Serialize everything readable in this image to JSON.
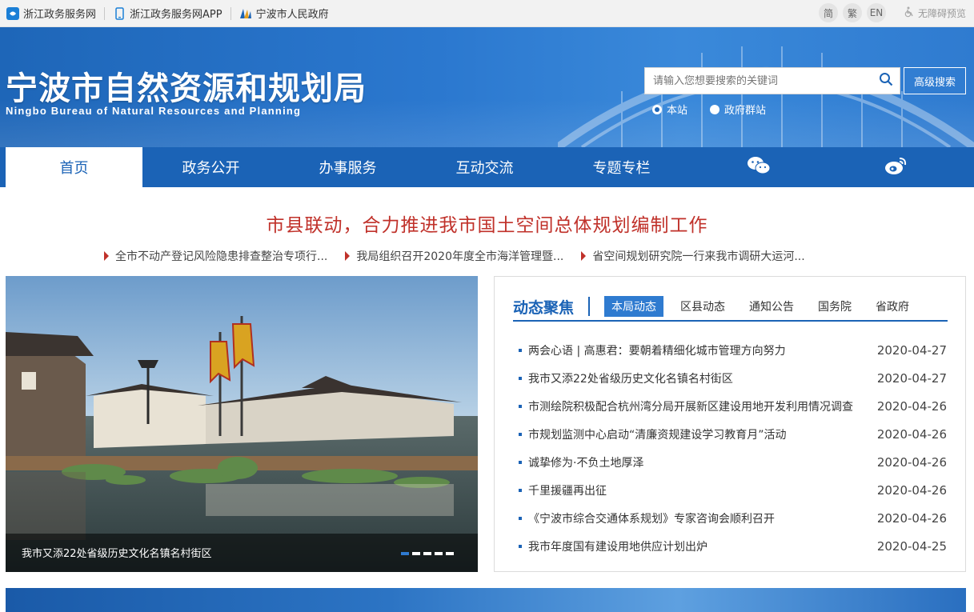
{
  "topbar": {
    "links": [
      {
        "label": "浙江政务服务网"
      },
      {
        "label": "浙江政务服务网APP"
      },
      {
        "label": "宁波市人民政府"
      }
    ],
    "lang": [
      "简",
      "繁",
      "EN"
    ],
    "accessibility": "无障碍预览"
  },
  "header": {
    "title": "宁波市自然资源和规划局",
    "subtitle": "Ningbo Bureau of Natural Resources and Planning",
    "search_placeholder": "请输入您想要搜索的关键词",
    "advanced_search": "高级搜索",
    "scope": [
      "本站",
      "政府群站"
    ]
  },
  "nav": {
    "items": [
      "首页",
      "政务公开",
      "办事服务",
      "互动交流",
      "专题专栏"
    ]
  },
  "headline": "市县联动，合力推进我市国土空间总体规划编制工作",
  "sublinks": [
    "全市不动产登记风险隐患排查整治专项行...",
    "我局组织召开2020年度全市海洋管理暨...",
    "省空间规划研究院一行来我市调研大运河..."
  ],
  "slider": {
    "caption": "我市又添22处省级历史文化名镇名村街区"
  },
  "news": {
    "title": "动态聚焦",
    "tabs": [
      "本局动态",
      "区县动态",
      "通知公告",
      "国务院",
      "省政府"
    ],
    "items": [
      {
        "title": "两会心语 | 高惠君：要朝着精细化城市管理方向努力",
        "date": "2020-04-27"
      },
      {
        "title": "我市又添22处省级历史文化名镇名村街区",
        "date": "2020-04-27"
      },
      {
        "title": "市测绘院积极配合杭州湾分局开展新区建设用地开发利用情况调查",
        "date": "2020-04-26"
      },
      {
        "title": "市规划监测中心启动“清廉资规建设学习教育月”活动",
        "date": "2020-04-26"
      },
      {
        "title": "诚挚修为·不负土地厚泽",
        "date": "2020-04-26"
      },
      {
        "title": "千里援疆再出征",
        "date": "2020-04-26"
      },
      {
        "title": "《宁波市综合交通体系规划》专家咨询会顺利召开",
        "date": "2020-04-26"
      },
      {
        "title": "我市年度国有建设用地供应计划出炉",
        "date": "2020-04-25"
      }
    ]
  }
}
